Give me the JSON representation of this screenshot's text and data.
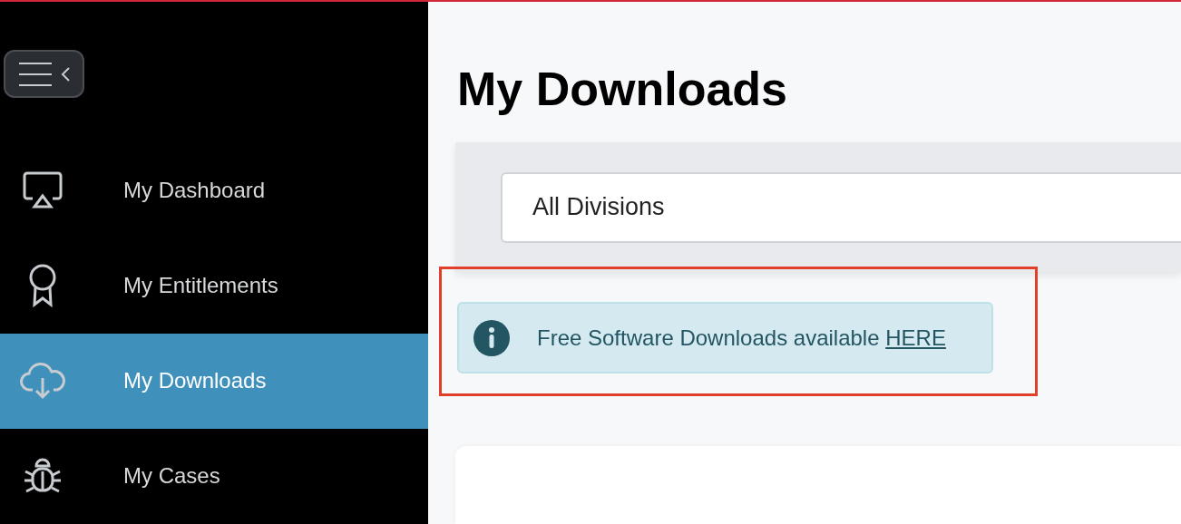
{
  "sidebar": {
    "items": [
      {
        "label": "My Dashboard",
        "kind": "dashboard",
        "selected": false
      },
      {
        "label": "My Entitlements",
        "kind": "award",
        "selected": false
      },
      {
        "label": "My Downloads",
        "kind": "download",
        "selected": true
      },
      {
        "label": "My Cases",
        "kind": "bug",
        "selected": false
      }
    ]
  },
  "page_title": "My Downloads",
  "division_select": {
    "value": "All Divisions"
  },
  "alert": {
    "text": "Free Software Downloads available ",
    "link": "HERE",
    "highlighted": true
  }
}
